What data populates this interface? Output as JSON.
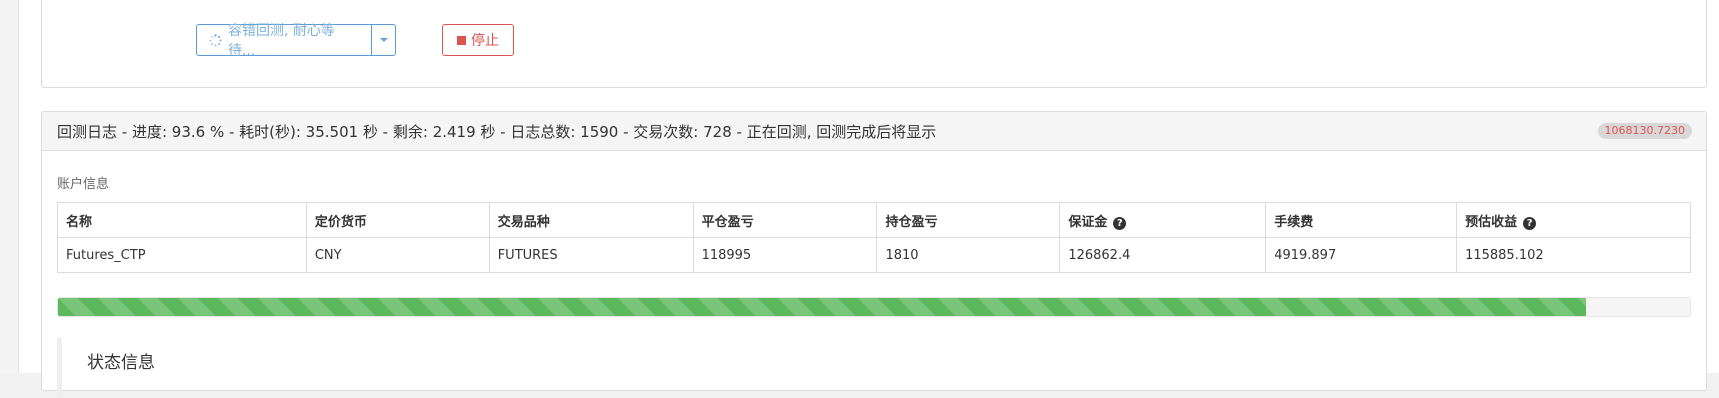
{
  "controls": {
    "running_button_label": "容错回测, 耐心等待...",
    "stop_button_label": "停止"
  },
  "log": {
    "header_text": "回测日志 - 进度: 93.6 % - 耗时(秒): 35.501 秒 - 剩余: 2.419 秒 - 日志总数: 1590 - 交易次数: 728 - 正在回测, 回测完成后将显示",
    "badge_value": "1068130.7230",
    "account_label": "账户信息",
    "columns": [
      "名称",
      "定价货币",
      "交易品种",
      "平仓盈亏",
      "持仓盈亏",
      "保证金",
      "手续费",
      "预估收益"
    ],
    "help_columns": [
      "保证金",
      "预估收益"
    ],
    "row": [
      "Futures_CTP",
      "CNY",
      "FUTURES",
      "118995",
      "1810",
      "126862.4",
      "4919.897",
      "115885.102"
    ],
    "progress_percent": 93.6,
    "status_title": "状态信息"
  },
  "icons": {
    "spinner": "spinner-icon",
    "caret": "caret-down-icon",
    "stop": "stop-icon",
    "help": "question-circle-icon"
  },
  "colors": {
    "primary_border": "#5b9bd5",
    "danger": "#d9534f",
    "progress": "#5cb85c",
    "badge_text": "#e05555"
  }
}
